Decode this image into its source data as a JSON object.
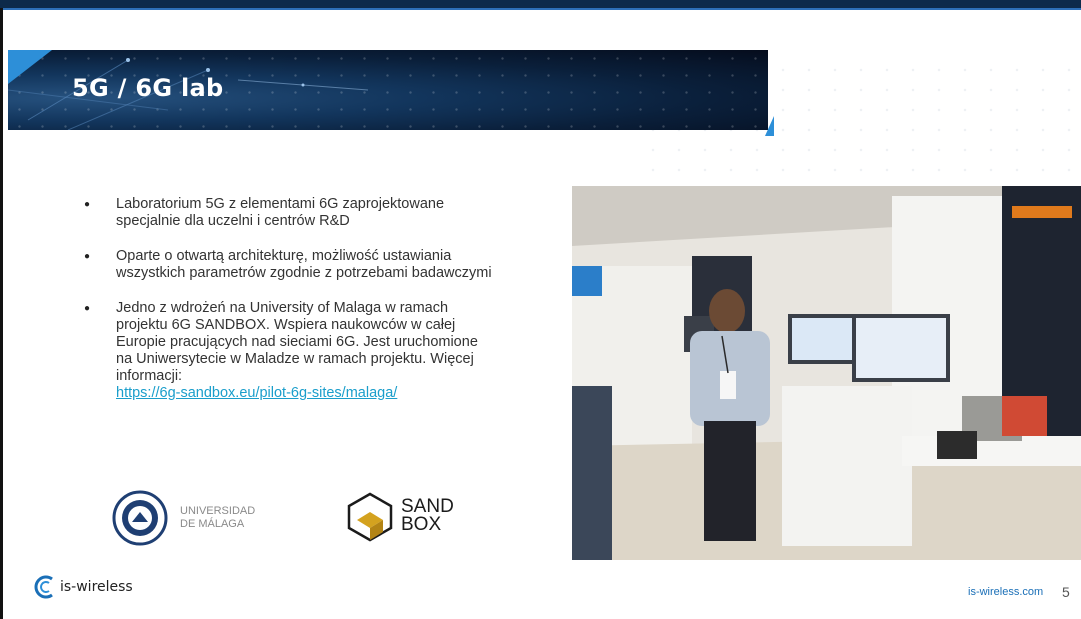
{
  "slide": {
    "title": "5G / 6G lab",
    "bullets": [
      "Laboratorium 5G z elementami 6G zaprojektowane specjalnie dla uczelni i centrów R&D",
      "Oparte o otwartą architekturę, możliwość ustawiania wszystkich parametrów zgodnie z potrzebami badawczymi",
      "Jedno z wdrożeń na University of Malaga w ramach projektu 6G SANDBOX. Wspiera naukowców w całej Europie pracujących nad sieciami 6G. Jest uruchomione na Uniwersytecie w Maladze w ramach projektu. Więcej informacji:"
    ],
    "link": "https://6g-sandbox.eu/pilot-6g-sites/malaga/",
    "logos": {
      "uma_line1": "UNIVERSIDAD",
      "uma_line2": "DE MÁLAGA",
      "sandbox_line1": "SAND",
      "sandbox_line2": "BOX"
    },
    "footer": {
      "brand": "is-wireless",
      "site": "is-wireless.com",
      "page_number": "5"
    }
  },
  "colors": {
    "accent": "#2d8fd8",
    "banner": "#0a1f3a",
    "link": "#1a9ecb"
  }
}
